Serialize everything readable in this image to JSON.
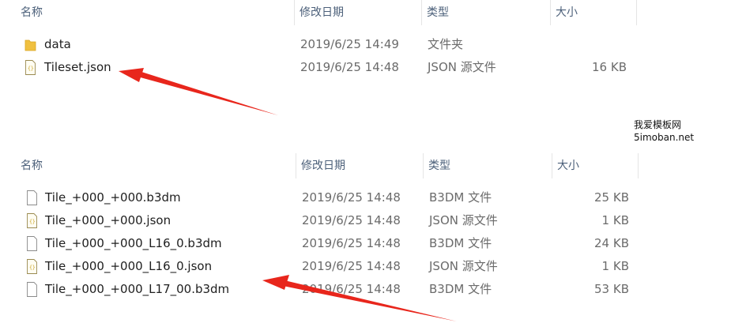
{
  "panel_top": {
    "columns": {
      "name": "名称",
      "date": "修改日期",
      "type": "类型",
      "size": "大小"
    },
    "rows": [
      {
        "icon": "folder-icon",
        "name": "data",
        "date": "2019/6/25 14:49",
        "type": "文件夹",
        "size": ""
      },
      {
        "icon": "json-file-icon",
        "name": "Tileset.json",
        "date": "2019/6/25 14:48",
        "type": "JSON 源文件",
        "size": "16 KB"
      }
    ]
  },
  "panel_bottom": {
    "columns": {
      "name": "名称",
      "date": "修改日期",
      "type": "类型",
      "size": "大小"
    },
    "rows": [
      {
        "icon": "file-icon",
        "name": "Tile_+000_+000.b3dm",
        "date": "2019/6/25 14:48",
        "type": "B3DM 文件",
        "size": "25 KB"
      },
      {
        "icon": "json-file-icon",
        "name": "Tile_+000_+000.json",
        "date": "2019/6/25 14:48",
        "type": "JSON 源文件",
        "size": "1 KB"
      },
      {
        "icon": "file-icon",
        "name": "Tile_+000_+000_L16_0.b3dm",
        "date": "2019/6/25 14:48",
        "type": "B3DM 文件",
        "size": "24 KB"
      },
      {
        "icon": "json-file-icon",
        "name": "Tile_+000_+000_L16_0.json",
        "date": "2019/6/25 14:48",
        "type": "JSON 源文件",
        "size": "1 KB"
      },
      {
        "icon": "file-icon",
        "name": "Tile_+000_+000_L17_00.b3dm",
        "date": "2019/6/25 14:48",
        "type": "B3DM 文件",
        "size": "53 KB"
      }
    ]
  },
  "watermark": {
    "line1": "我爱模板网",
    "line2": "5imoban.net"
  },
  "colors": {
    "arrow": "#e8261c",
    "header_text": "#4c607a",
    "folder": "#f0c040",
    "json_icon": "#c8a020"
  }
}
